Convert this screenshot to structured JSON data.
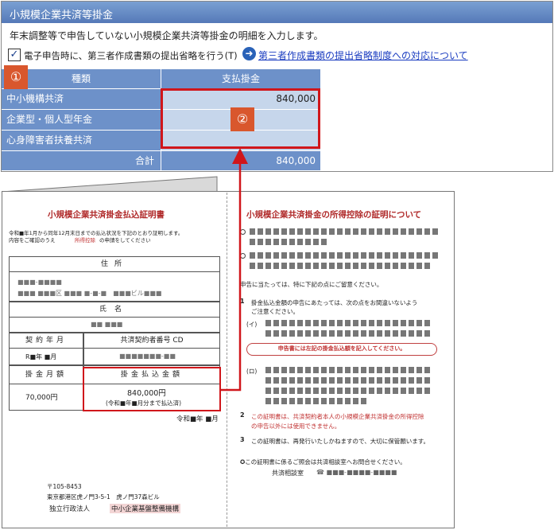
{
  "form": {
    "header": "小規模企業共済等掛金",
    "description": "年末調整等で申告していない小規模企業共済等掛金の明細を入力します。",
    "checkbox_checked": "✓",
    "checkbox_label": "電子申告時に、第三者作成書類の提出省略を行う(T)",
    "arrow_glyph": "➜",
    "link_text": "第三者作成書類の提出省略制度への対応について",
    "table": {
      "col_kind": "種類",
      "col_payment": "支払掛金",
      "rows": [
        {
          "label": "中小機構共済",
          "value": "840,000"
        },
        {
          "label": "企業型・個人型年金",
          "value": ""
        },
        {
          "label": "心身障害者扶養共済",
          "value": ""
        }
      ],
      "total_label": "合計",
      "total_value": "840,000"
    },
    "marker1": "①",
    "marker2": "②",
    "accent_color": "#6d91c9",
    "highlight_color": "#d0161b"
  },
  "certificate": {
    "title": "小規模企業共済掛金払込証明書",
    "note1": "令和■年1月から同年12月末日までの払込状況を下記のとおり証明します。",
    "note2a": "内容をご確認のうえ",
    "note2b": "所得控除",
    "note2c": "の申請をしてください",
    "address_head": "住所",
    "address_line1": "■■■-■■■■",
    "address_line2": "■■■ ■■■区 ■■■ ■-■-■　■■■ビル■■■",
    "name_head": "氏名",
    "name_value": "■■ ■■■",
    "contract_head": "契約年月",
    "number_head": "共済契約者番号 CD",
    "contract_value": "R■年 ■月",
    "number_value": "■■■■■■■-■■",
    "month_head": "掛金月額",
    "pay_head": "掛金払込金額",
    "month_value": "70,000円",
    "pay_value": "840,000円",
    "pay_sub": "(令和■年■月分まで払込済)",
    "date": "令和■年 ■月",
    "postal": "〒105-8453",
    "address": "東京都港区虎ノ門3-5-1　虎ノ門37森ビル",
    "org_label": "独立行政法人",
    "org_name": "中小企業基盤整備機構"
  },
  "explanation": {
    "title": "小規模企業共済掛金の所得控除の証明について",
    "note": "申告に当たっては、特に下記の点にご留意ください。",
    "n1": "1",
    "p1a": "掛金払込金額の申告にあたっては、次の点をお間違いないよう",
    "p1b": "ご注意ください。",
    "i": "(イ)",
    "pill": "申告書には左記の掛金払込額を記入してください。",
    "ro": "(ロ)",
    "n2": "2",
    "p2a": "この証明書は、共済契約者本人の小規模企業共済掛金の所得控除",
    "p2b": "の申告以外には使用できません。",
    "n3": "3",
    "p3": "この証明書は、再発行いたしかねますので、大切に保管願います。",
    "contact": "✪この証明書に係るご照会は共済相談室へお問合せください。",
    "office": "共済相談室",
    "phone": "☎ ■■■-■■■■-■■■■"
  }
}
